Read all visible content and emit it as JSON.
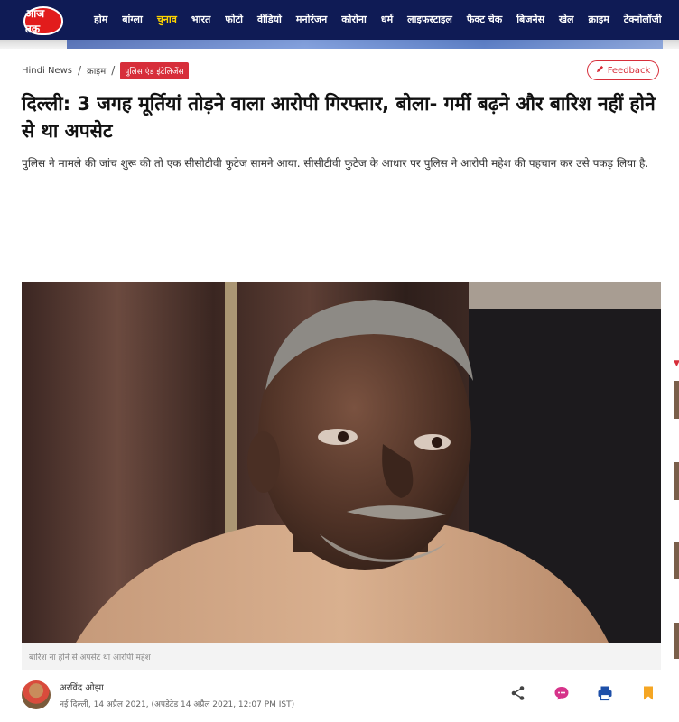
{
  "header": {
    "logo_text": "आज तक",
    "nav": [
      "होम",
      "बांग्ला",
      "चुनाव",
      "भारत",
      "फोटो",
      "वीडियो",
      "मनोरंजन",
      "कोरोना",
      "धर्म",
      "लाइफस्टाइल",
      "फैक्ट चेक",
      "बिजनेस",
      "खेल",
      "क्राइम",
      "टेक्नोलॉजी"
    ],
    "active_index": 2
  },
  "breadcrumb": {
    "home": "Hindi News",
    "section": "क्राइम",
    "tag": "पुलिस एंड इंटेलिजेंस"
  },
  "feedback_label": "Feedback",
  "article": {
    "headline": "दिल्ली: 3 जगह मूर्तियां तोड़ने वाला आरोपी गिरफ्तार, बोला- गर्मी बढ़ने और बारिश नहीं होने से था अपसेट",
    "summary": "पुलिस ने मामले की जांच शुरू की तो एक सीसीटीवी फुटेज सामने आया. सीसीटीवी फुटेज के आधार पर पुलिस ने आरोपी महेश की पहचान कर उसे पकड़ लिया है.",
    "photo_caption": "बारिश ना होने से अपसेट था आरोपी महेश",
    "author": "अरविंद ओझा",
    "dateline": "नई दिल्ली, 14 अप्रैल 2021, (अपडेटेड 14 अप्रैल 2021, 12:07 PM IST)"
  },
  "actions": [
    "share-icon",
    "comment-icon",
    "print-icon",
    "bookmark-icon"
  ],
  "colors": {
    "nav_bg": "#0f1b55",
    "active_nav": "#ffd400",
    "brand_red": "#d72e3a",
    "share": "#444444",
    "comment": "#d6338a",
    "print": "#1d4fa8",
    "bookmark": "#f5a623"
  }
}
